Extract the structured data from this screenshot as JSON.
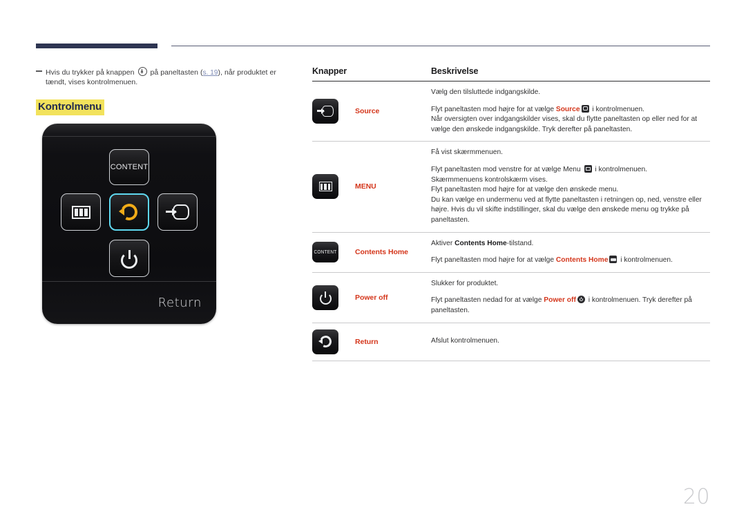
{
  "page": {
    "number": "20",
    "accent_navy": "#2e3552",
    "accent_red": "#d4361b",
    "highlight_yellow": "#f2e25c",
    "link_blue": "#7e8bb5",
    "focus_cyan": "#5fd8ef"
  },
  "note": {
    "text_before_icon": "Hvis du trykker på knappen",
    "icon": "power-button-icon",
    "text_after_icon": "på paneltasten",
    "link": "s. 19",
    "text_after_link": ", når produktet er tændt, vises kontrolmenuen."
  },
  "section": {
    "heading": "Kontrolmenu"
  },
  "device": {
    "label_return": "Return",
    "buttons": [
      {
        "name": "content",
        "label": "CONTENT",
        "icon": "content-icon",
        "focused": false
      },
      {
        "name": "menu",
        "label": "",
        "icon": "menu-icon",
        "focused": false
      },
      {
        "name": "return",
        "label": "",
        "icon": "return-icon",
        "focused": true
      },
      {
        "name": "source",
        "label": "",
        "icon": "source-icon",
        "focused": false
      },
      {
        "name": "power",
        "label": "",
        "icon": "power-icon",
        "focused": false
      }
    ]
  },
  "table": {
    "headers": {
      "buttons": "Knapper",
      "description": "Beskrivelse"
    },
    "rows": [
      {
        "icon": "source-icon",
        "name": "Source",
        "lines": [
          "Vælg den tilsluttede indgangskilde.",
          "Flyt paneltasten mod højre for at vælge Source  i kontrolmenuen.\nNår oversigten over indgangskilder vises, skal du flytte paneltasten op eller ned for at vælge den ønskede indgangskilde. Tryk derefter på paneltasten."
        ],
        "p1": "Vælg den tilsluttede indgangskilde.",
        "p2_a": "Flyt paneltasten mod højre for at vælge ",
        "p2_hl": "Source",
        "p2_b": " i kontrolmenuen.",
        "p2_c": "Når oversigten over indgangskilder vises, skal du flytte paneltasten op eller ned for at vælge den ønskede indgangskilde. Tryk derefter på paneltasten."
      },
      {
        "icon": "menu-icon",
        "name": "MENU",
        "p1": "Få vist skærmmenuen.",
        "p2_a": "Flyt paneltasten mod venstre for at vælge Menu ",
        "p2_hl": "",
        "p2_b": " i kontrolmenuen.",
        "p2_c": "Skærmmenuens kontrolskærm vises.",
        "p2_d": "Flyt paneltasten mod højre for at vælge den ønskede menu.",
        "p2_e": "Du kan vælge en undermenu ved at flytte paneltasten i retningen op, ned, venstre eller højre. Hvis du vil skifte indstillinger, skal du vælge den ønskede menu og trykke på paneltasten."
      },
      {
        "icon": "content-icon",
        "name": "Contents Home",
        "p1_a": "Aktiver ",
        "p1_hl": "Contents Home",
        "p1_b": "-tilstand.",
        "p2_a": "Flyt paneltasten mod højre for at vælge ",
        "p2_hl": "Contents Home",
        "p2_b": " i kontrolmenuen."
      },
      {
        "icon": "power-icon",
        "name": "Power off",
        "p1": "Slukker for produktet.",
        "p2_a": "Flyt paneltasten nedad for at vælge ",
        "p2_hl": "Power off",
        "p2_b": " i kontrolmenuen. Tryk derefter på paneltasten."
      },
      {
        "icon": "return-icon",
        "name": "Return",
        "p1": "Afslut kontrolmenuen."
      }
    ]
  }
}
